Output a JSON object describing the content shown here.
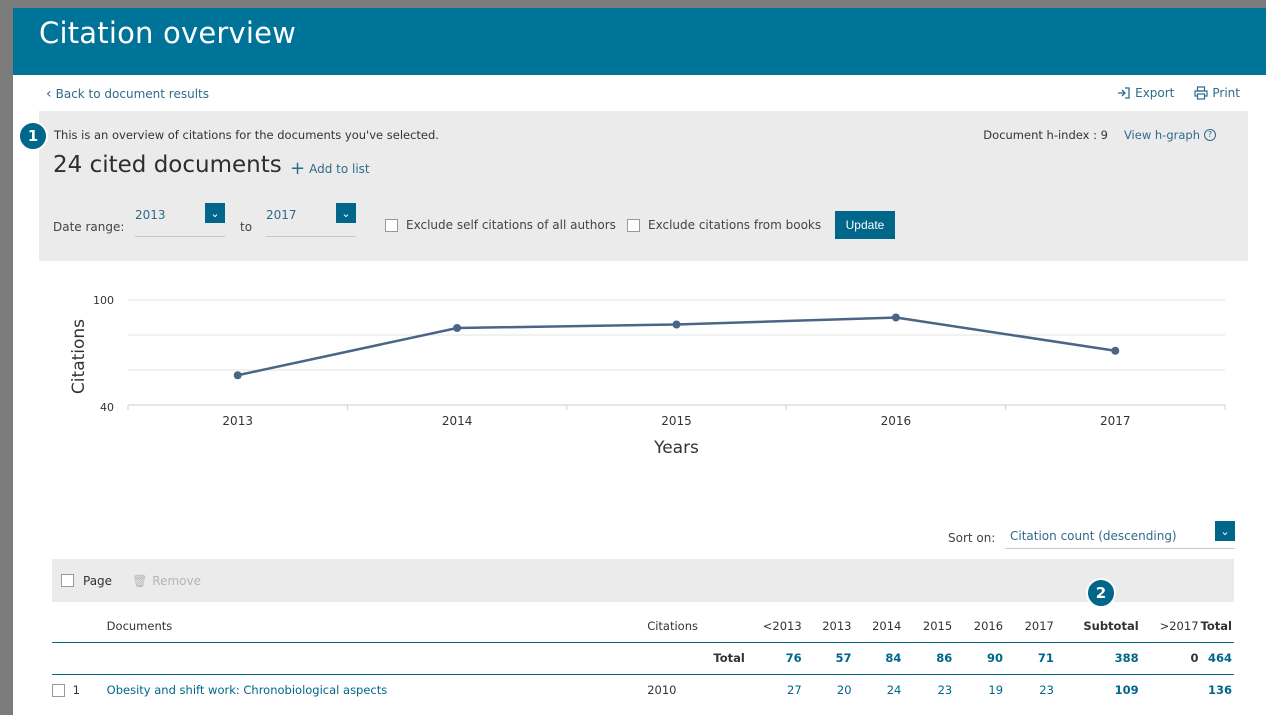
{
  "header": {
    "title": "Citation overview"
  },
  "nav": {
    "back_label": "Back to document results",
    "export_label": "Export",
    "print_label": "Print"
  },
  "summary": {
    "intro": "This is an overview of citations for the documents you've selected.",
    "hindex_label": "Document h-index : 9",
    "hgraph_label": "View h-graph",
    "cited_count": "24 cited documents",
    "add_to_list": "Add to list",
    "date_range_label": "Date range:",
    "date_from": "2013",
    "to_label": "to",
    "date_to": "2017",
    "exclude_self": "Exclude self citations of all authors",
    "exclude_books": "Exclude citations from books",
    "update_label": "Update"
  },
  "badges": {
    "one": "1",
    "two": "2"
  },
  "chart_data": {
    "type": "line",
    "x": [
      "2013",
      "2014",
      "2015",
      "2016",
      "2017"
    ],
    "values": [
      57,
      84,
      86,
      90,
      71
    ],
    "ylim": [
      40,
      100
    ],
    "yticks": [
      "100",
      "40"
    ],
    "xlabel": "Years",
    "ylabel": "Citations",
    "color": "#4a6586",
    "grid": true
  },
  "sort": {
    "label": "Sort on:",
    "value": "Citation count (descending)"
  },
  "table_toolbar": {
    "page_label": "Page",
    "remove_label": "Remove"
  },
  "table": {
    "headers": [
      "Documents",
      "Citations",
      "<2013",
      "2013",
      "2014",
      "2015",
      "2016",
      "2017",
      "Subtotal",
      ">2017",
      "Total"
    ],
    "total_row": {
      "label": "Total",
      "values": [
        "76",
        "57",
        "84",
        "86",
        "90",
        "71",
        "388",
        "0",
        "464"
      ]
    },
    "rows": [
      {
        "index": "1",
        "title": "Obesity and shift work: Chronobiological aspects",
        "year": "2010",
        "values": [
          "27",
          "20",
          "24",
          "23",
          "19",
          "23",
          "109",
          "",
          "136"
        ]
      }
    ]
  }
}
